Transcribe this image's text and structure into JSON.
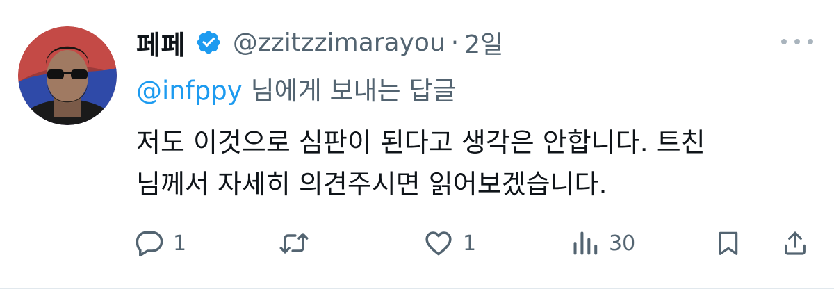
{
  "author": {
    "display_name": "페페",
    "handle": "@zzitzzimarayou",
    "separator": "·",
    "time": "2일",
    "verified": true,
    "verified_color": "#1d9bf0"
  },
  "reply": {
    "mention": "@infppy",
    "suffix": "님에게 보내는 답글"
  },
  "tweet": {
    "line1": "저도 이것으로 심판이 된다고 생각은 안합니다. 트친",
    "line2": "님께서 자세히 의견주시면 읽어보겠습니다."
  },
  "actions": {
    "reply_count": "1",
    "retweet_count": "",
    "like_count": "1",
    "views_count": "30"
  },
  "colors": {
    "text": "#0f1419",
    "secondary": "#536471",
    "link": "#1d9bf0"
  },
  "icons": [
    "avatar",
    "verified-badge-icon",
    "more-icon",
    "reply-icon",
    "retweet-icon",
    "like-icon",
    "views-icon",
    "bookmark-icon",
    "share-icon"
  ]
}
